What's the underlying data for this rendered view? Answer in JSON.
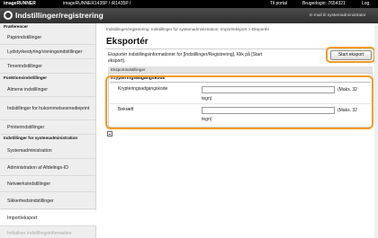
{
  "topbar": {
    "brand": "imageRUNNER",
    "model": "imageRUNNER1435P / iR1435P /",
    "portal": "Til portal",
    "user_label": "Brugerlogin: 7654321",
    "logout": "Log"
  },
  "header": {
    "title": "Indstillinger/registrering",
    "email": "E-mail til systemadministrator"
  },
  "sidebar": {
    "section1": "Præferencer",
    "items1": [
      "Papirindstillinger",
      "Lydstyrkestyring/visningsindstillinger",
      "Timerindstillinger"
    ],
    "section2": "Funktionsindstillinger",
    "items2": [
      "Almene indstillinger",
      "Indstillinger for hukommelsesmedieprint",
      "Printerindstillinger"
    ],
    "section3": "Indstillinger for systemadministration",
    "items3": [
      "Systemadministration",
      "Administration af Afdelings-ID",
      "Netværksindstillinger",
      "Sikkerhedsindstillinger",
      "Import/eksport",
      "Initialiser indstillingsinformation"
    ]
  },
  "main": {
    "breadcrumb": "Indstillinger/registrering: Indstillinger for systemadministration: Import/eksport > Eksportér",
    "title": "Eksportér",
    "description": "Eksportér indstillingsinformationer for [Indstillinger/Registrering]. Klik på [Start eksport].",
    "start_button": "Start eksport",
    "section_label": "Eksportindstillinger",
    "panel_title": "Krypteringsadgangskode",
    "field1_label": "Krypteringsadgangskode",
    "field1_value": "",
    "field1_hint": "(Maks. 32",
    "field1_hint2": "tegn)",
    "field2_label": "Bekræft",
    "field2_value": "",
    "field2_hint": "(Maks. 32",
    "field2_hint2": "tegn)"
  },
  "colors": {
    "highlight": "#f29a1f",
    "header": "#3a3a3a"
  }
}
